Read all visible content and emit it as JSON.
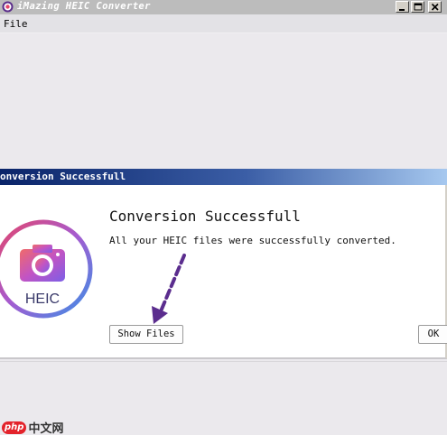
{
  "window": {
    "title": "iMazing HEIC Converter",
    "menu": {
      "file": "File"
    }
  },
  "dialog": {
    "title": "onversion Successfull",
    "heading": "Conversion Successfull",
    "message": "All your HEIC files were successfully converted.",
    "logo_text": "HEIC",
    "buttons": {
      "show_files": "Show Files",
      "ok": "OK"
    }
  },
  "watermark": {
    "badge": "php",
    "text": "中文网"
  },
  "colors": {
    "title_bar": "#bcbcbc",
    "dialog_title_gradient_start": "#0a2469",
    "dialog_title_gradient_end": "#a6c8ef",
    "arrow": "#5b2d8e",
    "logo_ring_start": "#e4456b",
    "logo_ring_end": "#3b8fe6"
  },
  "icons": {
    "app": "app-icon",
    "minimize": "minimize-icon",
    "maximize": "maximize-icon",
    "close": "close-icon",
    "logo": "camera-icon",
    "annotation": "arrow-icon"
  }
}
